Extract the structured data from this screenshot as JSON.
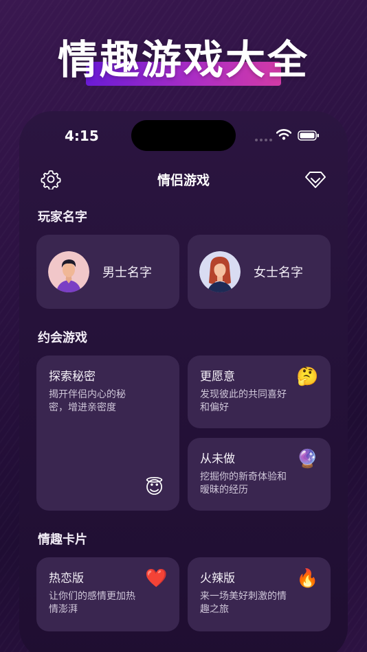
{
  "promo": {
    "title": "情趣游戏大全"
  },
  "status_bar": {
    "time": "4:15"
  },
  "nav": {
    "title": "情侣游戏",
    "settings_icon": "gear-icon",
    "premium_icon": "diamond-icon"
  },
  "players": {
    "section_label": "玩家名字",
    "male": {
      "name": "男士名字"
    },
    "female": {
      "name": "女士名字"
    }
  },
  "dating_games": {
    "section_label": "约会游戏",
    "items": [
      {
        "title": "探索秘密",
        "desc": "揭开伴侣内心的秘密，增进亲密度",
        "emoji": "😇"
      },
      {
        "title": "更愿意",
        "desc": "发现彼此的共同喜好和偏好",
        "emoji": "🤔"
      },
      {
        "title": "从未做",
        "desc": "挖掘你的新奇体验和暧昧的经历",
        "emoji": "🔮"
      }
    ]
  },
  "fun_cards": {
    "section_label": "情趣卡片",
    "items": [
      {
        "title": "热恋版",
        "desc": "让你们的感情更加热情澎湃",
        "emoji": "❤️"
      },
      {
        "title": "火辣版",
        "desc": "来一场美好刺激的情趣之旅",
        "emoji": "🔥"
      }
    ]
  },
  "colors": {
    "card_bg": "#3a2650",
    "promo_bar_start": "#6a1bd6",
    "promo_bar_end": "#d23aa6"
  }
}
